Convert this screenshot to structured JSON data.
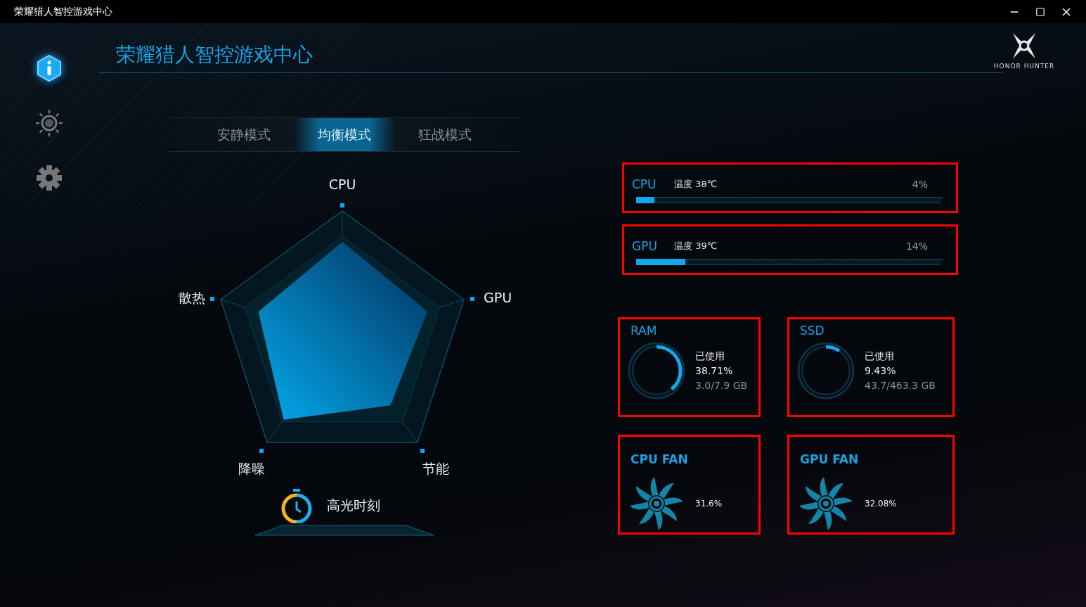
{
  "window": {
    "title": "荣耀猎人智控游戏中心"
  },
  "header": {
    "title": "荣耀猎人智控游戏中心",
    "logo_text": "HONOR HUNTER"
  },
  "sidebar": {
    "items": [
      {
        "kind": "info",
        "selected": true
      },
      {
        "kind": "tuning",
        "selected": false
      },
      {
        "kind": "settings",
        "selected": false
      }
    ]
  },
  "tabs": [
    {
      "label": "安静模式",
      "selected": false
    },
    {
      "label": "均衡模式",
      "selected": true
    },
    {
      "label": "狂战模式",
      "selected": false
    }
  ],
  "radar": {
    "axes": [
      "CPU",
      "GPU",
      "节能",
      "降噪",
      "散热"
    ]
  },
  "highlight": {
    "label": "高光时刻"
  },
  "usage_bars": [
    {
      "name": "CPU",
      "temperature": "温度 38℃",
      "reading": "4%",
      "level": 0.06
    },
    {
      "name": "GPU",
      "temperature": "温度 39℃",
      "reading": "14%",
      "level": 0.16
    }
  ],
  "storage": [
    {
      "name": "RAM",
      "caption": "已使用",
      "percent": "38.71%",
      "amount": "3.0/7.9 GB"
    },
    {
      "name": "SSD",
      "caption": "已使用",
      "percent": "9.43%",
      "amount": "43.7/463.3 GB"
    }
  ],
  "fans": [
    {
      "name": "CPU FAN",
      "reading": "31.6%"
    },
    {
      "name": "GPU FAN",
      "reading": "32.08%"
    }
  ]
}
